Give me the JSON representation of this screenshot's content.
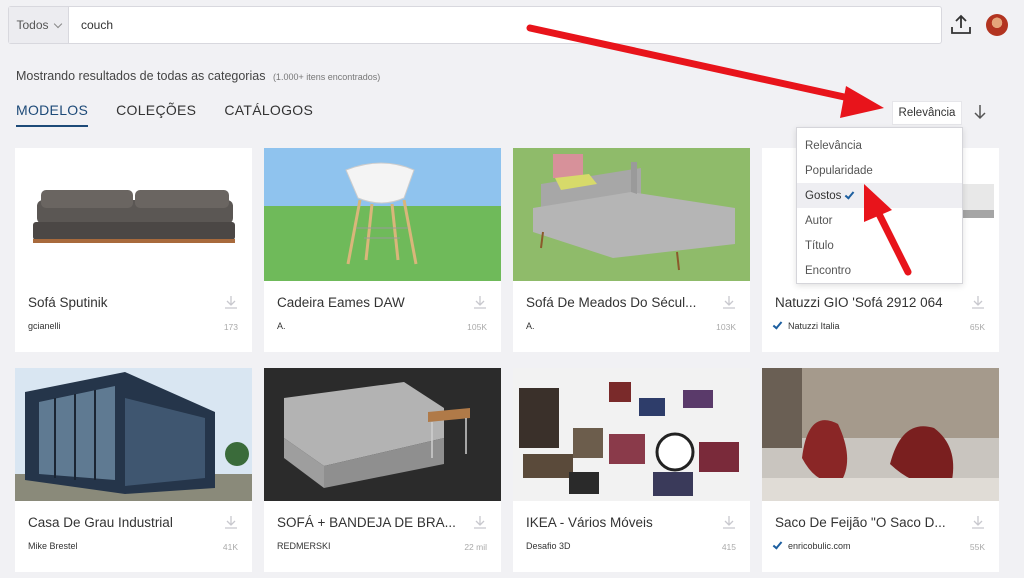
{
  "search": {
    "scope": "Todos",
    "query": "couch"
  },
  "results": {
    "text": "Mostrando resultados de todas as categorias",
    "count": "(1.000+ itens encontrados)"
  },
  "tabs": [
    "MODELOS",
    "COLEÇÕES",
    "CATÁLOGOS"
  ],
  "sort": {
    "label": "Relevância",
    "options": [
      "Relevância",
      "Popularidade",
      "Gostos",
      "Autor",
      "Título",
      "Encontro"
    ],
    "selected_index": 2
  },
  "cards": [
    {
      "title": "Sofá Sputinik",
      "author": "gcianelli",
      "count": "173",
      "verified": false
    },
    {
      "title": "Cadeira Eames DAW",
      "author": "A.",
      "count": "105K",
      "verified": false
    },
    {
      "title": "Sofá De Meados Do Sécul...",
      "author": "A.",
      "count": "103K",
      "verified": false
    },
    {
      "title": "Natuzzi GIO 'Sofá 2912 064",
      "author": "Natuzzi Italia",
      "count": "65K",
      "verified": true
    },
    {
      "title": "Casa De Grau Industrial",
      "author": "Mike Brestel",
      "count": "41K",
      "verified": false
    },
    {
      "title": "SOFÁ + BANDEJA DE BRA...",
      "author": "REDMERSKI",
      "count": "22 mil",
      "verified": false
    },
    {
      "title": "IKEA - Vários Móveis",
      "author": "Desafio 3D",
      "count": "415",
      "verified": false
    },
    {
      "title": "Saco De Feijão \"O Saco D...",
      "author": "enricobulic.com",
      "count": "55K",
      "verified": true
    }
  ],
  "colors": {
    "accent": "#1d4a78",
    "arrow": "#e8141b",
    "background": "#f1f1f4"
  }
}
